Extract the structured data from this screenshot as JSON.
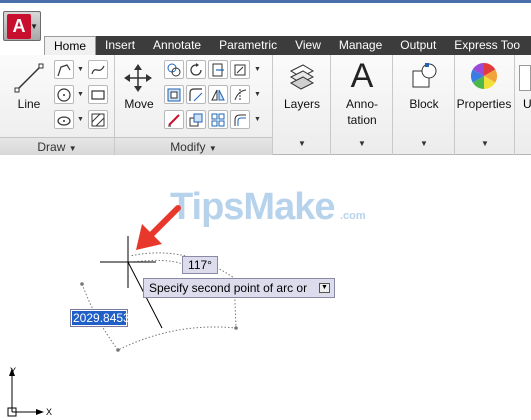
{
  "app": {
    "logo_letter": "A",
    "accent_color": "#c8102e"
  },
  "tabs": [
    {
      "label": "Home",
      "active": true
    },
    {
      "label": "Insert",
      "active": false
    },
    {
      "label": "Annotate",
      "active": false
    },
    {
      "label": "Parametric",
      "active": false
    },
    {
      "label": "View",
      "active": false
    },
    {
      "label": "Manage",
      "active": false
    },
    {
      "label": "Output",
      "active": false
    },
    {
      "label": "Express Too",
      "active": false
    }
  ],
  "ribbon": {
    "draw": {
      "title": "Draw",
      "line_label": "Line"
    },
    "modify": {
      "title": "Modify",
      "move_label": "Move"
    },
    "layers_label": "Layers",
    "annotation_label_1": "Anno-",
    "annotation_label_2": "tation",
    "block_label": "Block",
    "properties_label": "Properties"
  },
  "canvas": {
    "watermark": "TipsMake",
    "watermark_suffix": ".com",
    "angle_value": "117°",
    "prompt_text": "Specify second point of arc or",
    "distance_value": "2029.8453",
    "ucs_x_label": "X",
    "ucs_y_label": "Y"
  }
}
